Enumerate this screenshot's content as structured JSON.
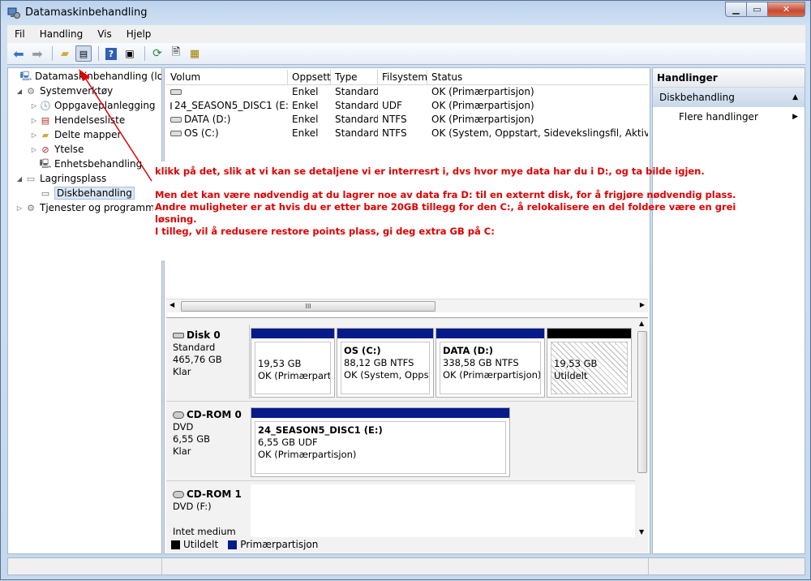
{
  "window": {
    "title": "Datamaskinbehandling"
  },
  "menu": [
    "Fil",
    "Handling",
    "Vis",
    "Hjelp"
  ],
  "tree": {
    "root": "Datamaskinbehandling (lokal)",
    "systemverktoy": "Systemverktøy",
    "oppgave": "Oppgaveplanlegging",
    "hendelse": "Hendelsesliste",
    "delte": "Delte mapper",
    "ytelse": "Ytelse",
    "enhet": "Enhetsbehandling",
    "lagring": "Lagringsplass",
    "disk": "Diskbehandling",
    "tjenester": "Tjenester og programmer"
  },
  "volumes": {
    "columns": [
      "Volum",
      "Oppsett",
      "Type",
      "Filsystem",
      "Status"
    ],
    "rows": [
      [
        "",
        "Enkel",
        "Standard",
        "",
        "OK (Primærpartisjon)"
      ],
      [
        "24_SEASON5_DISC1 (E:)",
        "Enkel",
        "Standard",
        "UDF",
        "OK (Primærpartisjon)"
      ],
      [
        "DATA (D:)",
        "Enkel",
        "Standard",
        "NTFS",
        "OK (Primærpartisjon)"
      ],
      [
        "OS (C:)",
        "Enkel",
        "Standard",
        "NTFS",
        "OK (System, Oppstart, Sidevekslingsfil, Aktiv, Krasjd"
      ]
    ]
  },
  "scroll_glyph": "III",
  "disks": {
    "disk0": {
      "name": "Disk 0",
      "kind": "Standard",
      "size": "465,76 GB",
      "state": "Klar"
    },
    "cd0": {
      "name": "CD-ROM 0",
      "kind": "DVD",
      "size": "6,55 GB",
      "state": "Klar"
    },
    "cd1": {
      "name": "CD-ROM 1",
      "kind": "DVD (F:)",
      "state": "Intet medium"
    }
  },
  "partitions": {
    "p1": {
      "size": "19,53 GB",
      "status": "OK (Primærpartis"
    },
    "p2": {
      "title": "OS  (C:)",
      "size": "88,12 GB NTFS",
      "status": "OK (System, Oppsta"
    },
    "p3": {
      "title": "DATA  (D:)",
      "size": "338,58 GB NTFS",
      "status": "OK (Primærpartisjon)"
    },
    "p4": {
      "size": "19,53 GB",
      "status": "Utildelt"
    },
    "e": {
      "title": "24_SEASON5_DISC1  (E:)",
      "size": "6,55 GB UDF",
      "status": "OK (Primærpartisjon)"
    }
  },
  "legend": {
    "unallocated": "Utildelt",
    "primary": "Primærpartisjon"
  },
  "actions": {
    "header": "Handlinger",
    "section": "Diskbehandling",
    "more": "Flere handlinger"
  },
  "annotation": {
    "line1": "klikk på det, slik at vi kan se detaljene vi er interresrt i, dvs hvor mye data har du i D:, og ta bilde igjen.",
    "line2": "Men det kan være nødvendig at du lagrer noe av data fra D: til en externt disk, for å frigjøre nødvendig plass.",
    "line3": "Andre muligheter er at hvis du er etter bare 20GB tillegg for den C:, å relokalisere en del foldere  være en grei",
    "line4": "løsning.",
    "line5": "I tilleg, vil å redusere restore points plass, gi deg extra GB på C:"
  },
  "colors": {
    "annotation": "#e00000",
    "primary_partition": "#071a8a",
    "unallocated": "#000000"
  }
}
